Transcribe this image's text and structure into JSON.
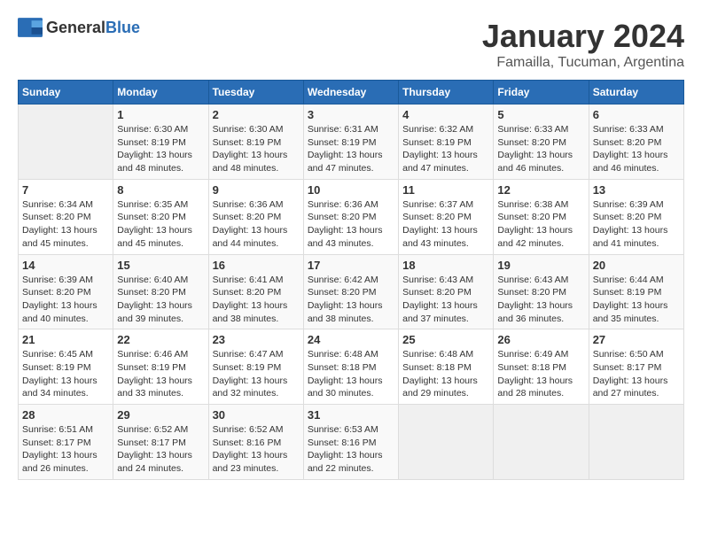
{
  "header": {
    "logo_general": "General",
    "logo_blue": "Blue",
    "month": "January 2024",
    "location": "Famailla, Tucuman, Argentina"
  },
  "days_of_week": [
    "Sunday",
    "Monday",
    "Tuesday",
    "Wednesday",
    "Thursday",
    "Friday",
    "Saturday"
  ],
  "weeks": [
    [
      {
        "day": "",
        "sunrise": "",
        "sunset": "",
        "daylight": "",
        "empty": true
      },
      {
        "day": "1",
        "sunrise": "Sunrise: 6:30 AM",
        "sunset": "Sunset: 8:19 PM",
        "daylight": "Daylight: 13 hours and 48 minutes."
      },
      {
        "day": "2",
        "sunrise": "Sunrise: 6:30 AM",
        "sunset": "Sunset: 8:19 PM",
        "daylight": "Daylight: 13 hours and 48 minutes."
      },
      {
        "day": "3",
        "sunrise": "Sunrise: 6:31 AM",
        "sunset": "Sunset: 8:19 PM",
        "daylight": "Daylight: 13 hours and 47 minutes."
      },
      {
        "day": "4",
        "sunrise": "Sunrise: 6:32 AM",
        "sunset": "Sunset: 8:19 PM",
        "daylight": "Daylight: 13 hours and 47 minutes."
      },
      {
        "day": "5",
        "sunrise": "Sunrise: 6:33 AM",
        "sunset": "Sunset: 8:20 PM",
        "daylight": "Daylight: 13 hours and 46 minutes."
      },
      {
        "day": "6",
        "sunrise": "Sunrise: 6:33 AM",
        "sunset": "Sunset: 8:20 PM",
        "daylight": "Daylight: 13 hours and 46 minutes."
      }
    ],
    [
      {
        "day": "7",
        "sunrise": "Sunrise: 6:34 AM",
        "sunset": "Sunset: 8:20 PM",
        "daylight": "Daylight: 13 hours and 45 minutes."
      },
      {
        "day": "8",
        "sunrise": "Sunrise: 6:35 AM",
        "sunset": "Sunset: 8:20 PM",
        "daylight": "Daylight: 13 hours and 45 minutes."
      },
      {
        "day": "9",
        "sunrise": "Sunrise: 6:36 AM",
        "sunset": "Sunset: 8:20 PM",
        "daylight": "Daylight: 13 hours and 44 minutes."
      },
      {
        "day": "10",
        "sunrise": "Sunrise: 6:36 AM",
        "sunset": "Sunset: 8:20 PM",
        "daylight": "Daylight: 13 hours and 43 minutes."
      },
      {
        "day": "11",
        "sunrise": "Sunrise: 6:37 AM",
        "sunset": "Sunset: 8:20 PM",
        "daylight": "Daylight: 13 hours and 43 minutes."
      },
      {
        "day": "12",
        "sunrise": "Sunrise: 6:38 AM",
        "sunset": "Sunset: 8:20 PM",
        "daylight": "Daylight: 13 hours and 42 minutes."
      },
      {
        "day": "13",
        "sunrise": "Sunrise: 6:39 AM",
        "sunset": "Sunset: 8:20 PM",
        "daylight": "Daylight: 13 hours and 41 minutes."
      }
    ],
    [
      {
        "day": "14",
        "sunrise": "Sunrise: 6:39 AM",
        "sunset": "Sunset: 8:20 PM",
        "daylight": "Daylight: 13 hours and 40 minutes."
      },
      {
        "day": "15",
        "sunrise": "Sunrise: 6:40 AM",
        "sunset": "Sunset: 8:20 PM",
        "daylight": "Daylight: 13 hours and 39 minutes."
      },
      {
        "day": "16",
        "sunrise": "Sunrise: 6:41 AM",
        "sunset": "Sunset: 8:20 PM",
        "daylight": "Daylight: 13 hours and 38 minutes."
      },
      {
        "day": "17",
        "sunrise": "Sunrise: 6:42 AM",
        "sunset": "Sunset: 8:20 PM",
        "daylight": "Daylight: 13 hours and 38 minutes."
      },
      {
        "day": "18",
        "sunrise": "Sunrise: 6:43 AM",
        "sunset": "Sunset: 8:20 PM",
        "daylight": "Daylight: 13 hours and 37 minutes."
      },
      {
        "day": "19",
        "sunrise": "Sunrise: 6:43 AM",
        "sunset": "Sunset: 8:20 PM",
        "daylight": "Daylight: 13 hours and 36 minutes."
      },
      {
        "day": "20",
        "sunrise": "Sunrise: 6:44 AM",
        "sunset": "Sunset: 8:19 PM",
        "daylight": "Daylight: 13 hours and 35 minutes."
      }
    ],
    [
      {
        "day": "21",
        "sunrise": "Sunrise: 6:45 AM",
        "sunset": "Sunset: 8:19 PM",
        "daylight": "Daylight: 13 hours and 34 minutes."
      },
      {
        "day": "22",
        "sunrise": "Sunrise: 6:46 AM",
        "sunset": "Sunset: 8:19 PM",
        "daylight": "Daylight: 13 hours and 33 minutes."
      },
      {
        "day": "23",
        "sunrise": "Sunrise: 6:47 AM",
        "sunset": "Sunset: 8:19 PM",
        "daylight": "Daylight: 13 hours and 32 minutes."
      },
      {
        "day": "24",
        "sunrise": "Sunrise: 6:48 AM",
        "sunset": "Sunset: 8:18 PM",
        "daylight": "Daylight: 13 hours and 30 minutes."
      },
      {
        "day": "25",
        "sunrise": "Sunrise: 6:48 AM",
        "sunset": "Sunset: 8:18 PM",
        "daylight": "Daylight: 13 hours and 29 minutes."
      },
      {
        "day": "26",
        "sunrise": "Sunrise: 6:49 AM",
        "sunset": "Sunset: 8:18 PM",
        "daylight": "Daylight: 13 hours and 28 minutes."
      },
      {
        "day": "27",
        "sunrise": "Sunrise: 6:50 AM",
        "sunset": "Sunset: 8:17 PM",
        "daylight": "Daylight: 13 hours and 27 minutes."
      }
    ],
    [
      {
        "day": "28",
        "sunrise": "Sunrise: 6:51 AM",
        "sunset": "Sunset: 8:17 PM",
        "daylight": "Daylight: 13 hours and 26 minutes."
      },
      {
        "day": "29",
        "sunrise": "Sunrise: 6:52 AM",
        "sunset": "Sunset: 8:17 PM",
        "daylight": "Daylight: 13 hours and 24 minutes."
      },
      {
        "day": "30",
        "sunrise": "Sunrise: 6:52 AM",
        "sunset": "Sunset: 8:16 PM",
        "daylight": "Daylight: 13 hours and 23 minutes."
      },
      {
        "day": "31",
        "sunrise": "Sunrise: 6:53 AM",
        "sunset": "Sunset: 8:16 PM",
        "daylight": "Daylight: 13 hours and 22 minutes."
      },
      {
        "day": "",
        "sunrise": "",
        "sunset": "",
        "daylight": "",
        "empty": true
      },
      {
        "day": "",
        "sunrise": "",
        "sunset": "",
        "daylight": "",
        "empty": true
      },
      {
        "day": "",
        "sunrise": "",
        "sunset": "",
        "daylight": "",
        "empty": true
      }
    ]
  ]
}
